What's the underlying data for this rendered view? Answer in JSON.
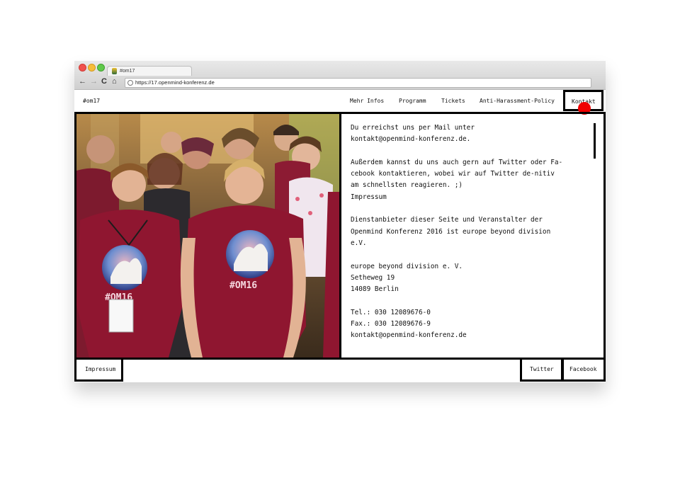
{
  "browser": {
    "tab_title": "#om17",
    "url": "https://17.openmind-konferenz.de",
    "back_glyph": "←",
    "forward_glyph": "→",
    "reload_glyph": "C",
    "home_glyph": "⌂"
  },
  "site": {
    "brand": "#om17",
    "nav": [
      "Mehr Infos",
      "Programm",
      "Tickets",
      "Anti-Harassment-Policy",
      "Kontakt"
    ],
    "active_nav": "Kontakt",
    "content_lines": [
      "Du erreichst uns per Mail unter",
      "kontakt@openmind-konferenz.de.",
      "",
      "Außerdem kannst du uns auch gern auf Twitter oder Fa-",
      "cebook kontaktieren, wobei wir auf Twitter de-nitiv",
      "am schnellsten reagieren. ;)",
      "Impressum",
      "",
      "Dienstanbieter dieser Seite und Veranstalter der",
      "Openmind Konferenz 2016 ist europe beyond division",
      "e.V.",
      "",
      "europe beyond division e. V.",
      "Setheweg 19",
      "14089 Berlin",
      "",
      "Tel.: 030 12089676-0",
      "Fax.: 030 12089676-9",
      "kontakt@openmind-konferenz.de"
    ],
    "photo_shirt_text": "#OM16",
    "footer": {
      "impressum": "Impressum",
      "twitter": "Twitter",
      "facebook": "Facebook"
    }
  },
  "colors": {
    "cursor_dot": "#f00000",
    "shirt": "#8f1630",
    "border": "#000000"
  }
}
